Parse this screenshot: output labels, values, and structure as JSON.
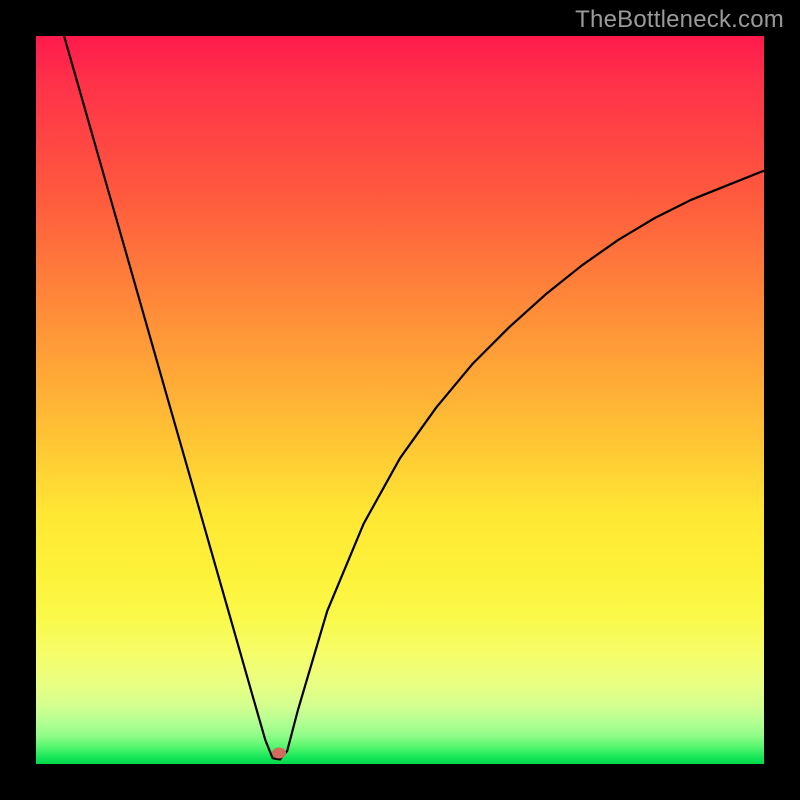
{
  "attribution": "TheBottleneck.com",
  "marker": {
    "x_frac": 0.334,
    "y_frac": 0.985
  },
  "chart_data": {
    "type": "line",
    "title": "",
    "xlabel": "",
    "ylabel": "",
    "xlim": [
      0,
      1
    ],
    "ylim": [
      0,
      1
    ],
    "x": [
      0.0,
      0.03,
      0.06,
      0.09,
      0.12,
      0.15,
      0.18,
      0.21,
      0.24,
      0.27,
      0.3,
      0.315,
      0.325,
      0.335,
      0.345,
      0.36,
      0.4,
      0.45,
      0.5,
      0.55,
      0.6,
      0.65,
      0.7,
      0.75,
      0.8,
      0.85,
      0.9,
      0.95,
      1.0
    ],
    "values": [
      1.14,
      1.03,
      0.925,
      0.82,
      0.715,
      0.61,
      0.505,
      0.4,
      0.295,
      0.19,
      0.085,
      0.033,
      0.008,
      0.006,
      0.018,
      0.075,
      0.21,
      0.33,
      0.42,
      0.49,
      0.55,
      0.6,
      0.645,
      0.685,
      0.72,
      0.75,
      0.775,
      0.795,
      0.815
    ],
    "note": "y is bottleneck magnitude (0 at optimum near x≈0.33, rising either side). Curve occupies full plot width; left branch exits top at x≈0. Values are read from pixel geometry; no axis tick labels are shown in the image."
  },
  "colors": {
    "top": "#ff1a4d",
    "mid": "#ffe834",
    "bottom": "#00d84a",
    "marker": "#d46a5d",
    "curve": "#000000",
    "frame": "#000000",
    "attribution": "#9a9a9a"
  }
}
